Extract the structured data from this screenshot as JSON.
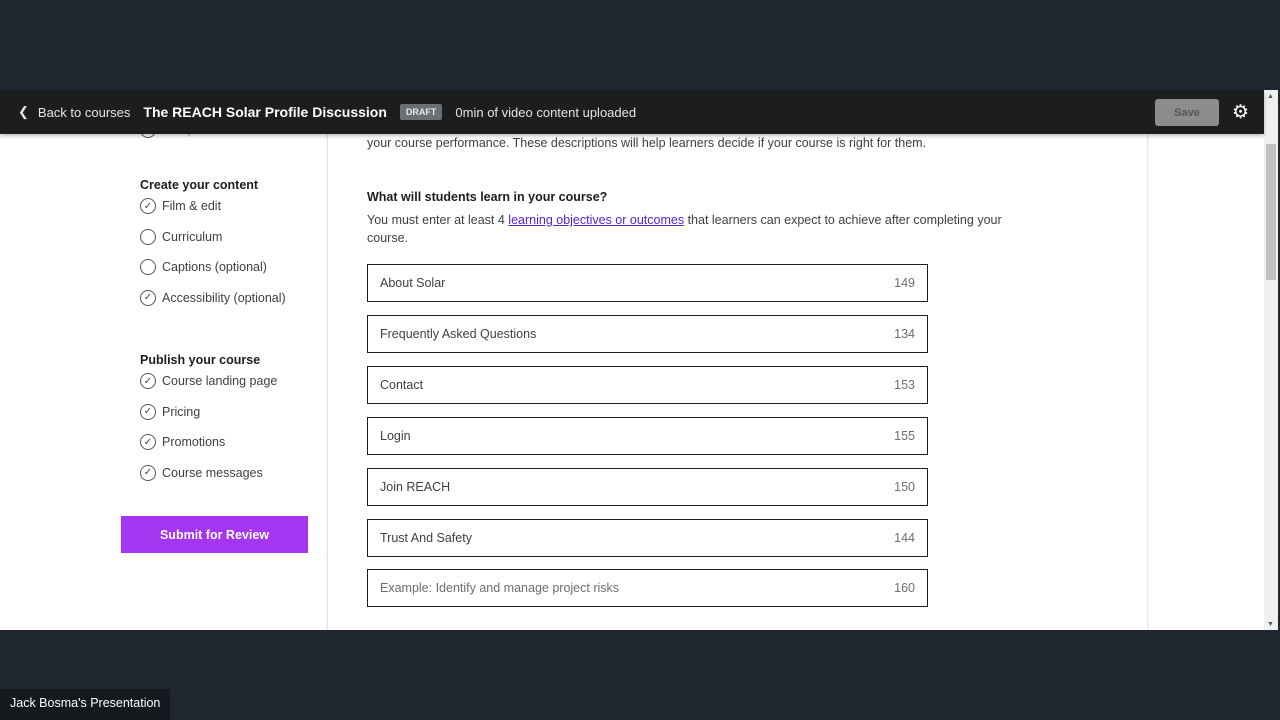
{
  "header": {
    "back_label": "Back to courses",
    "title": "The REACH Solar Profile Discussion",
    "badge": "DRAFT",
    "status": "0min of video content uploaded",
    "save_label": "Save"
  },
  "sidebar": {
    "partial_item": "Setup & test video",
    "sections": [
      {
        "title": "Create your content",
        "items": [
          {
            "label": "Film & edit",
            "checked": true
          },
          {
            "label": "Curriculum",
            "checked": false
          },
          {
            "label": "Captions (optional)",
            "checked": false
          },
          {
            "label": "Accessibility (optional)",
            "checked": true
          }
        ]
      },
      {
        "title": "Publish your course",
        "items": [
          {
            "label": "Course landing page",
            "checked": true
          },
          {
            "label": "Pricing",
            "checked": true
          },
          {
            "label": "Promotions",
            "checked": true
          },
          {
            "label": "Course messages",
            "checked": true
          }
        ]
      }
    ],
    "submit_label": "Submit for Review"
  },
  "main": {
    "intro_tail": "your course performance. These descriptions will help learners decide if your course is right for them.",
    "question": "What will students learn in your course?",
    "desc_before": "You must enter at least 4 ",
    "desc_link": "learning objectives or outcomes",
    "desc_after": " that learners can expect to achieve after completing your course.",
    "objectives": [
      {
        "value": "About Solar",
        "count": "149"
      },
      {
        "value": "Frequently Asked Questions",
        "count": "134"
      },
      {
        "value": "Contact",
        "count": "153"
      },
      {
        "value": "Login",
        "count": "155"
      },
      {
        "value": "Join REACH",
        "count": "150"
      },
      {
        "value": "Trust And Safety",
        "count": "144"
      },
      {
        "value": "",
        "placeholder": "Example: Identify and manage project risks",
        "count": "160"
      }
    ]
  },
  "footer": {
    "presenter": "Jack Bosma's Presentation"
  },
  "colors": {
    "accent": "#a435f0",
    "link": "#5624d0",
    "header_bg": "#1c1d1f"
  }
}
